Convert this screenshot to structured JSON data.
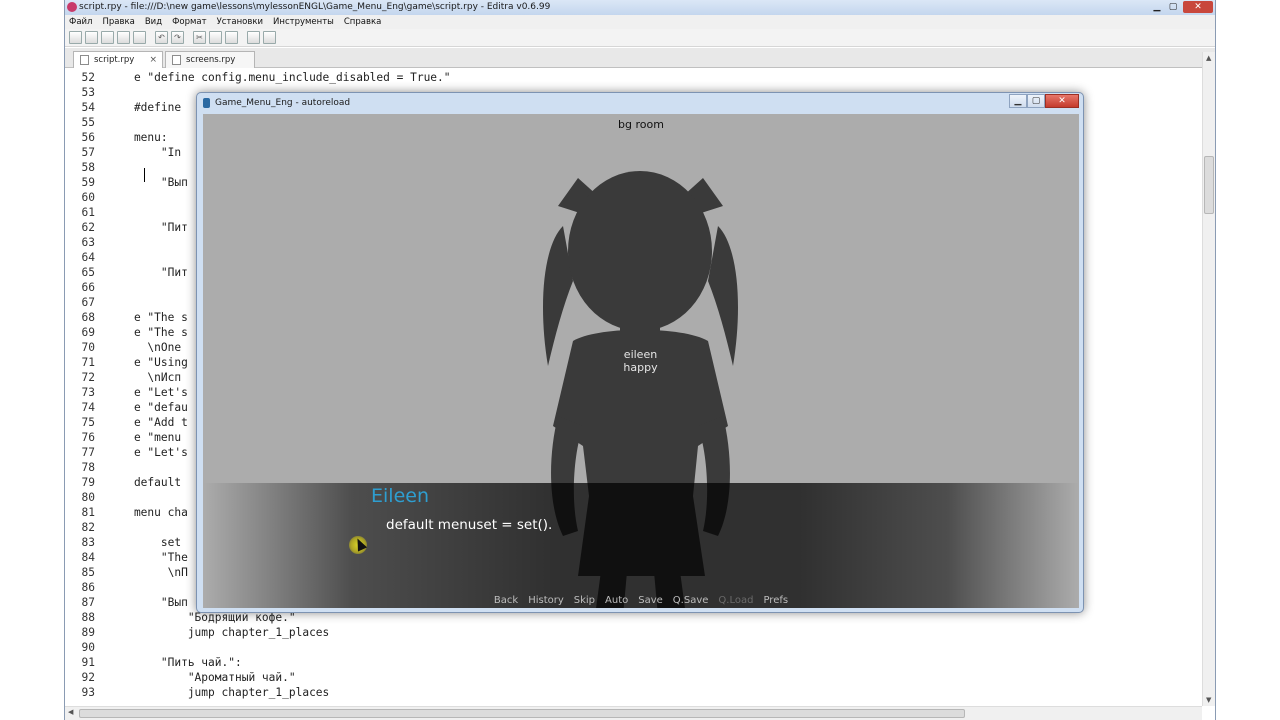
{
  "editor": {
    "title": "script.rpy - file:///D:\\new game\\lessons\\mylessonENGL\\Game_Menu_Eng\\game\\script.rpy - Editra v0.6.99",
    "window_buttons": {
      "minimize": "▁",
      "maximize": "▢",
      "close": "✕"
    },
    "menu": [
      "Файл",
      "Правка",
      "Вид",
      "Формат",
      "Установки",
      "Инструменты",
      "Справка"
    ],
    "toolbar": [
      "new-file-icon",
      "open-folder-icon",
      "save-icon",
      "save-all-icon",
      "print-icon",
      "undo-icon",
      "redo-icon",
      "cut-icon",
      "copy-icon",
      "paste-icon",
      "find-icon",
      "replace-icon"
    ],
    "tabs": [
      {
        "label": "script.rpy",
        "close": "×"
      },
      {
        "label": "screens.rpy"
      }
    ],
    "tab_menu": "▾",
    "code_lines": [
      {
        "n": "52",
        "t": "    e \"define config.menu_include_disabled = True.\""
      },
      {
        "n": "53",
        "t": ""
      },
      {
        "n": "54",
        "t": "    #define"
      },
      {
        "n": "55",
        "t": ""
      },
      {
        "n": "56",
        "t": "    menu:"
      },
      {
        "n": "57",
        "t": "        \"In"
      },
      {
        "n": "58",
        "t": ""
      },
      {
        "n": "59",
        "t": "        \"Вып"
      },
      {
        "n": "60",
        "t": ""
      },
      {
        "n": "61",
        "t": ""
      },
      {
        "n": "62",
        "t": "        \"Пит"
      },
      {
        "n": "63",
        "t": ""
      },
      {
        "n": "64",
        "t": ""
      },
      {
        "n": "65",
        "t": "        \"Пит"
      },
      {
        "n": "66",
        "t": ""
      },
      {
        "n": "67",
        "t": ""
      },
      {
        "n": "68",
        "t": "    e \"The s"
      },
      {
        "n": "69",
        "t": "    e \"The s"
      },
      {
        "n": "70",
        "t": "      \\nOne"
      },
      {
        "n": "71",
        "t": "    e \"Using"
      },
      {
        "n": "72",
        "t": "      \\nИсп"
      },
      {
        "n": "73",
        "t": "    e \"Let's"
      },
      {
        "n": "74",
        "t": "    e \"defau"
      },
      {
        "n": "75",
        "t": "    e \"Add t"
      },
      {
        "n": "76",
        "t": "    e \"menu"
      },
      {
        "n": "77",
        "t": "    e \"Let's"
      },
      {
        "n": "78",
        "t": ""
      },
      {
        "n": "79",
        "t": "    default"
      },
      {
        "n": "80",
        "t": ""
      },
      {
        "n": "81",
        "t": "    menu cha"
      },
      {
        "n": "82",
        "t": ""
      },
      {
        "n": "83",
        "t": "        set"
      },
      {
        "n": "84",
        "t": "        \"The"
      },
      {
        "n": "85",
        "t": "         \\nП"
      },
      {
        "n": "86",
        "t": ""
      },
      {
        "n": "87",
        "t": "        \"Вып"
      },
      {
        "n": "88",
        "t": "            \"Бодрящий кофе.\""
      },
      {
        "n": "89",
        "t": "            jump chapter_1_places"
      },
      {
        "n": "90",
        "t": ""
      },
      {
        "n": "91",
        "t": "        \"Пить чай.\":"
      },
      {
        "n": "92",
        "t": "            \"Ароматный чай.\""
      },
      {
        "n": "93",
        "t": "            jump chapter_1_places"
      }
    ]
  },
  "game": {
    "title": "Game_Menu_Eng - autoreload",
    "window_buttons": {
      "minimize": "▁",
      "maximize": "▢",
      "close": "✕"
    },
    "bg_label": "bg room",
    "sprite_label_line1": "eileen",
    "sprite_label_line2": "happy",
    "speaker": "Eileen",
    "dialogue": "default menuset = set().",
    "quick_menu": [
      {
        "label": "Back",
        "enabled": true
      },
      {
        "label": "History",
        "enabled": true
      },
      {
        "label": "Skip",
        "enabled": true
      },
      {
        "label": "Auto",
        "enabled": true
      },
      {
        "label": "Save",
        "enabled": true
      },
      {
        "label": "Q.Save",
        "enabled": true
      },
      {
        "label": "Q.Load",
        "enabled": false
      },
      {
        "label": "Prefs",
        "enabled": true
      }
    ],
    "colors": {
      "speaker": "#2e9ed0",
      "background": "#acacac",
      "silhouette": "#3a3a3a"
    }
  }
}
